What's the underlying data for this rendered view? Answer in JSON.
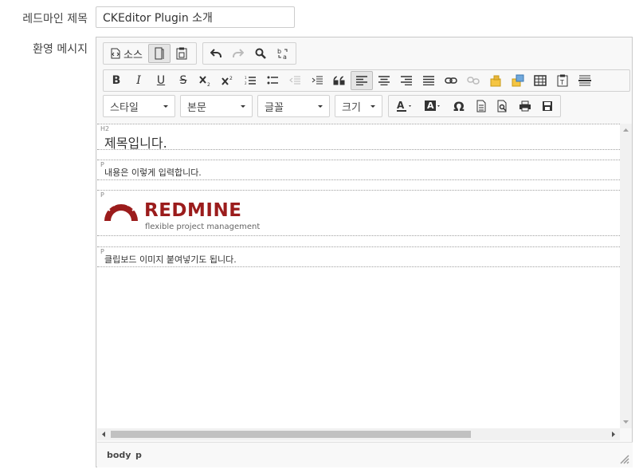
{
  "form": {
    "title_label": "레드마인 제목",
    "title_value": "CKEditor Plugin 소개",
    "welcome_label": "환영 메시지"
  },
  "toolbar": {
    "source_label": "소스",
    "style_combo": "스타일",
    "format_combo": "본문",
    "font_combo": "글꼴",
    "size_combo": "크기",
    "bold": "B",
    "italic": "I",
    "underline": "U",
    "strike": "S",
    "special_char": "Ω"
  },
  "content": {
    "blocks": [
      {
        "tag": "H2",
        "text": "제목입니다."
      },
      {
        "tag": "P",
        "text": "내용은 이렇게 입력합니다."
      },
      {
        "tag": "P",
        "image_alt": "REDMINE",
        "logo_text": "REDMINE",
        "logo_subtext": "flexible project management"
      },
      {
        "tag": "P",
        "text": "클립보드 이미지 붙여넣기도 됩니다."
      }
    ]
  },
  "footer": {
    "path": [
      "body",
      "p"
    ]
  },
  "colors": {
    "logo_red": "#9b1c1c",
    "toolbar_bg": "#f8f8f8",
    "border": "#d1d1d1"
  }
}
